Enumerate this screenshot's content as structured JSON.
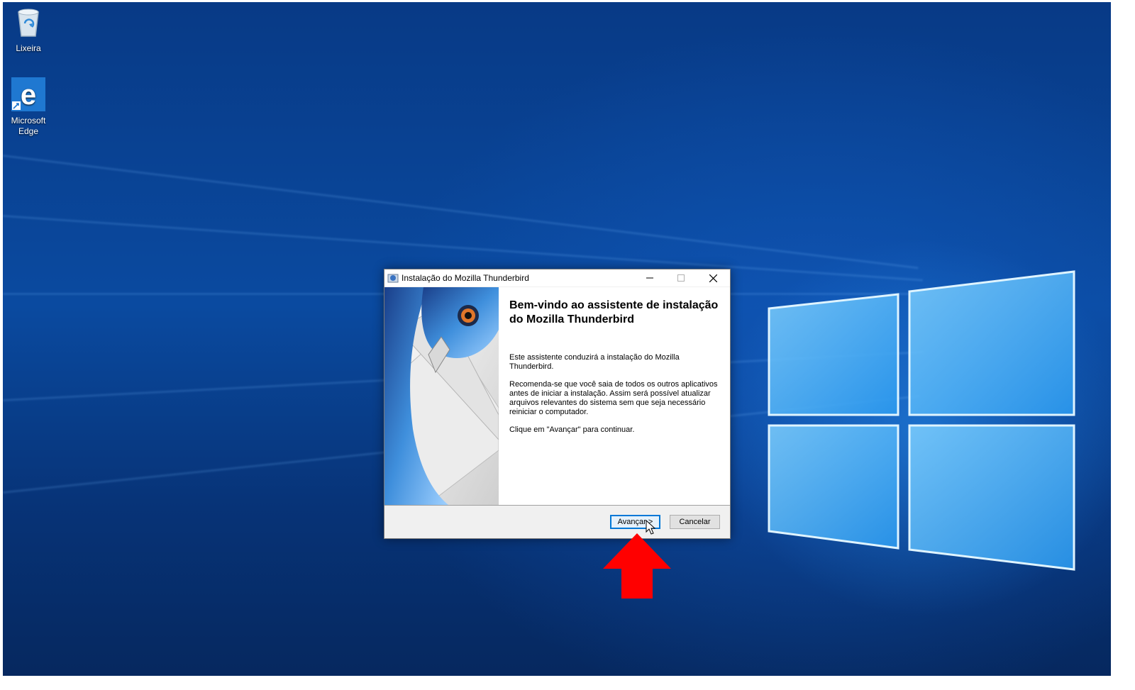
{
  "desktop": {
    "icons": [
      {
        "label": "Lixeira",
        "icon": "recycle-bin-icon"
      },
      {
        "label": "Microsoft\nEdge",
        "icon": "edge-icon"
      }
    ]
  },
  "dialog": {
    "title": "Instalação do Mozilla Thunderbird",
    "heading": "Bem-vindo ao assistente de instalação do Mozilla Thunderbird",
    "paragraph1": "Este assistente conduzirá a instalação do Mozilla Thunderbird.",
    "paragraph2": "Recomenda-se que você saia de todos os outros aplicativos antes de iniciar a instalação. Assim será possível atualizar arquivos relevantes do sistema sem que seja necessário reiniciar o computador.",
    "paragraph3": "Clique em \"Avançar\" para continuar.",
    "next_label": "Avançar >",
    "cancel_label": "Cancelar"
  },
  "annotation": {
    "arrow_color": "#ff0000"
  },
  "colors": {
    "accent": "#0078d7",
    "wallpaper": "#0a4aa0"
  }
}
